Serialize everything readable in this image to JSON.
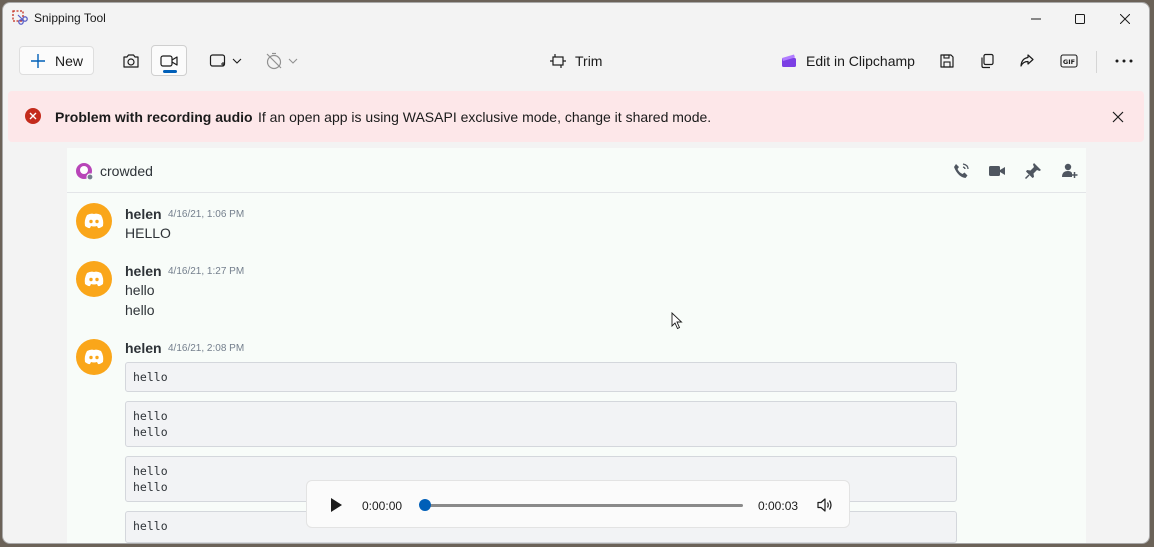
{
  "app": {
    "title": "Snipping Tool"
  },
  "toolbar": {
    "new_label": "New",
    "trim_label": "Trim",
    "clipchamp_label": "Edit in Clipchamp"
  },
  "error": {
    "title": "Problem with recording audio",
    "message": "If an open app is using WASAPI exclusive mode, change it shared mode."
  },
  "chat": {
    "channel": "crowded",
    "messages": [
      {
        "author": "helen",
        "timestamp": "4/16/21, 1:06 PM",
        "lines": [
          "HELLO"
        ]
      },
      {
        "author": "helen",
        "timestamp": "4/16/21, 1:27 PM",
        "lines": [
          "hello",
          "hello"
        ]
      },
      {
        "author": "helen",
        "timestamp": "4/16/21, 2:08 PM",
        "code_blocks": [
          [
            "hello"
          ],
          [
            "hello",
            "hello"
          ],
          [
            "hello",
            "hello"
          ],
          [
            "hello"
          ]
        ]
      }
    ]
  },
  "player": {
    "current_time": "0:00:00",
    "total_time": "0:00:03",
    "progress": 0
  },
  "colors": {
    "accent": "#005fb8",
    "error": "#c42b1c",
    "error_bg": "#fde7e9",
    "avatar": "#faa61a"
  }
}
